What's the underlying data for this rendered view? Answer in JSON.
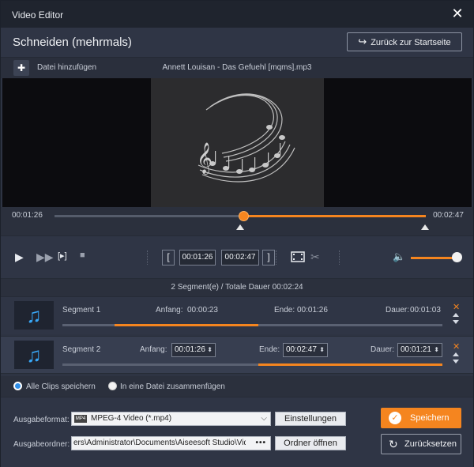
{
  "window": {
    "title": "Video Editor"
  },
  "header": {
    "title": "Schneiden (mehrmals)",
    "back_label": "Zurück zur Startseite"
  },
  "filebar": {
    "add_label": "Datei hinzufügen",
    "filename": "Annett Louisan - Das Gefuehl [mqms].mp3"
  },
  "timeline": {
    "current_time": "00:01:26",
    "total_time": "00:02:47",
    "playhead_fraction": 0.515
  },
  "controls": {
    "start_time": "00:01:26",
    "end_time": "00:02:47",
    "volume_fraction": 1.0
  },
  "segment_info": "2 Segment(e) / Totale Dauer 00:02:24",
  "labels": {
    "start": "Anfang:",
    "end": "Ende:",
    "duration": "Dauer:"
  },
  "segments": [
    {
      "name": "Segment 1",
      "start": "00:00:23",
      "end": "00:01:26",
      "duration": "00:01:03"
    },
    {
      "name": "Segment 2",
      "start": "00:01:26",
      "end": "00:02:47",
      "duration": "00:01:21"
    }
  ],
  "options": {
    "save_all": "Alle Clips speichern",
    "merge": "In eine Datei zusammenfügen",
    "selected": "save_all"
  },
  "output": {
    "format_label": "Ausgabeformat:",
    "format_value": "MPEG-4 Video (*.mp4)",
    "settings_label": "Einstellungen",
    "folder_label": "Ausgabeordner:",
    "folder_value": "ers\\Administrator\\Documents\\Aiseesoft Studio\\Video",
    "open_folder_label": "Ordner öffnen"
  },
  "actions": {
    "save_label": "Speichern",
    "reset_label": "Zurücksetzen"
  },
  "colors": {
    "accent": "#f5851f",
    "music_icon": "#38a6f5",
    "background": "#2e3443"
  },
  "icons": {
    "close": "close-icon",
    "back": "return-arrow-icon",
    "add_file": "add-file-icon",
    "music": "music-note-icon",
    "play": "play-icon",
    "fast_forward": "fast-forward-icon",
    "frame": "frame-step-icon",
    "stop": "stop-icon",
    "film": "film-clip-icon",
    "scissors": "scissors-icon",
    "volume": "volume-icon",
    "check": "check-icon",
    "reset": "reset-icon"
  }
}
